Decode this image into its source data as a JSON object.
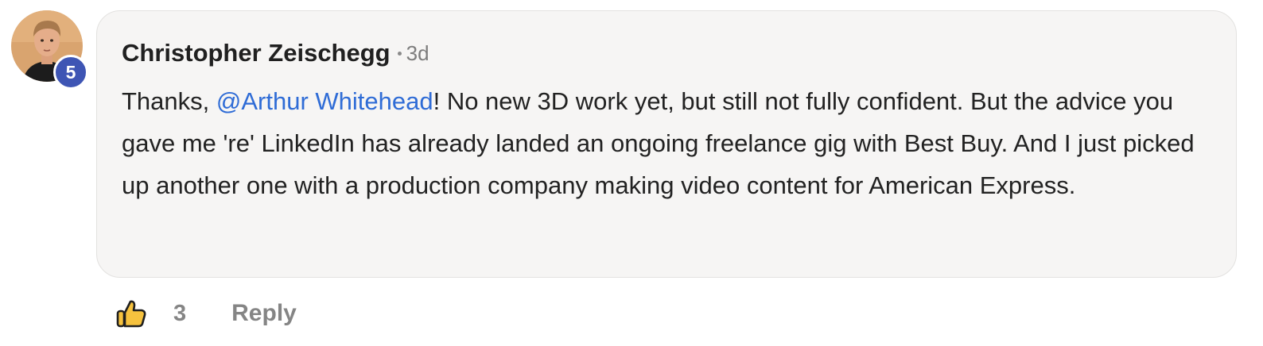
{
  "comment": {
    "author": "Christopher Zeischegg",
    "level_badge": "5",
    "timestamp": "3d",
    "text_before_mention": "Thanks, ",
    "mention": "@Arthur Whitehead",
    "text_after_mention": "! No new 3D work yet, but still not fully confident. But the advice you gave me 're' LinkedIn has already landed an ongoing freelance gig with Best Buy. And I just picked up another one with a production company making video content for American Express."
  },
  "actions": {
    "like_count": "3",
    "reply_label": "Reply",
    "like_icon": "thumbs-up-icon"
  },
  "colors": {
    "bubble_background": "#f6f5f4",
    "mention": "#2f6cd6",
    "level_badge": "#3e55b4",
    "like_icon_fill": "#f6c23e"
  }
}
